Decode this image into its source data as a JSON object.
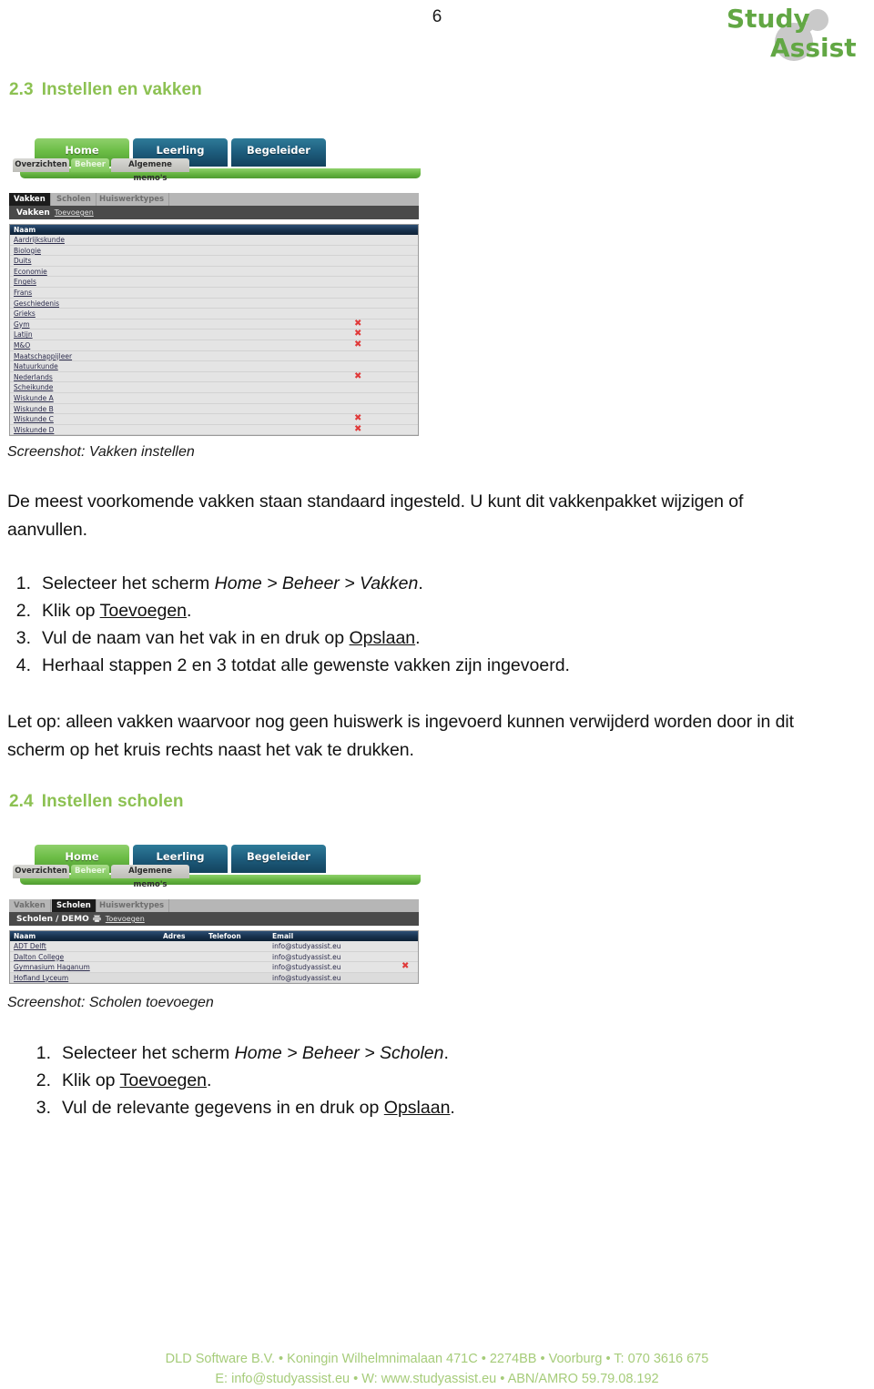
{
  "page": {
    "number": "6",
    "logo": {
      "word1": "Study",
      "word2": "Assist",
      "color": "#62a744",
      "shape_color": "#c9c9c9"
    }
  },
  "sections": [
    {
      "number": "2.3",
      "title": "Instellen en vakken",
      "caption": "Screenshot: Vakken instellen",
      "paragraph": "De meest voorkomende vakken staan standaard ingesteld. U kunt dit vakkenpakket  wijzigen of aanvullen.",
      "steps": [
        {
          "n": "1.",
          "pre": "Selecteer het scherm ",
          "italic": "Home > Beheer > Vakken",
          "post": "."
        },
        {
          "n": "2.",
          "pre": "Klik op ",
          "underline": "Toevoegen",
          "post": "."
        },
        {
          "n": "3.",
          "pre": "Vul de naam van het vak in en druk op ",
          "underline": "Opslaan",
          "post": "."
        },
        {
          "n": "4.",
          "pre": "Herhaal stappen 2 en 3 totdat alle gewenste vakken zijn ingevoerd.",
          "post": ""
        }
      ],
      "note": "Let op: alleen vakken waarvoor nog geen huiswerk is ingevoerd kunnen verwijderd worden door in dit scherm op het kruis rechts naast het vak te drukken."
    },
    {
      "number": "2.4",
      "title": "Instellen scholen",
      "caption": "Screenshot: Scholen toevoegen",
      "steps": [
        {
          "n": "1.",
          "pre": "Selecteer het scherm ",
          "italic": "Home > Beheer > Scholen",
          "post": "."
        },
        {
          "n": "2.",
          "pre": "Klik op ",
          "underline": "Toevoegen",
          "post": "."
        },
        {
          "n": "3.",
          "pre": "Vul de relevante gegevens in en druk op ",
          "underline": "Opslaan",
          "post": "."
        }
      ]
    }
  ],
  "app": {
    "main_tabs": [
      {
        "label": "Home",
        "state": "active",
        "color": "#6cbd46"
      },
      {
        "label": "Leerling",
        "state": "inactive",
        "color": "#1d5c7c"
      },
      {
        "label": "Begeleider",
        "state": "inactive",
        "color": "#1d5c7c"
      }
    ],
    "sub_tabs": [
      {
        "label": "Overzichten",
        "state": "inactive"
      },
      {
        "label": "Beheer",
        "state": "active"
      },
      {
        "label": "Algemene memo's",
        "state": "inactive"
      }
    ],
    "module_tabs": [
      "Vakken",
      "Scholen",
      "Huiswerktypes"
    ],
    "toevoegen_link": "Toevoegen",
    "vakken": {
      "active_module": "Vakken",
      "breadcrumb": "Vakken",
      "column_header": "Naam",
      "rows": [
        {
          "name": "Aardrijkskunde",
          "deletable": false
        },
        {
          "name": "Biologie",
          "deletable": false
        },
        {
          "name": "Duits",
          "deletable": false
        },
        {
          "name": "Economie",
          "deletable": false
        },
        {
          "name": "Engels",
          "deletable": false
        },
        {
          "name": "Frans",
          "deletable": false
        },
        {
          "name": "Geschiedenis",
          "deletable": false
        },
        {
          "name": "Grieks",
          "deletable": false
        },
        {
          "name": "Gym",
          "deletable": true
        },
        {
          "name": "Latijn",
          "deletable": true
        },
        {
          "name": "M&O",
          "deletable": true
        },
        {
          "name": "Maatschappijleer",
          "deletable": false
        },
        {
          "name": "Natuurkunde",
          "deletable": false
        },
        {
          "name": "Nederlands",
          "deletable": true
        },
        {
          "name": "Scheikunde",
          "deletable": false
        },
        {
          "name": "Wiskunde A",
          "deletable": false
        },
        {
          "name": "Wiskunde B",
          "deletable": false
        },
        {
          "name": "Wiskunde C",
          "deletable": true
        },
        {
          "name": "Wiskunde D",
          "deletable": true
        }
      ]
    },
    "scholen": {
      "active_module": "Scholen",
      "breadcrumb": "Scholen / DEMO",
      "columns": [
        "Naam",
        "Adres",
        "Telefoon",
        "Email"
      ],
      "rows": [
        {
          "name": "ADT Delft",
          "adres": "",
          "telefoon": "",
          "email": "info@studyassist.eu",
          "deletable": false
        },
        {
          "name": "Dalton College",
          "adres": "",
          "telefoon": "",
          "email": "info@studyassist.eu",
          "deletable": false
        },
        {
          "name": "Gymnasium Haganum",
          "adres": "",
          "telefoon": "",
          "email": "info@studyassist.eu",
          "deletable": true
        },
        {
          "name": "Hofland Lyceum",
          "adres": "",
          "telefoon": "",
          "email": "info@studyassist.eu",
          "deletable": false
        }
      ]
    },
    "delete_icon": "✖"
  },
  "footer": {
    "line1": "DLD Software B.V. • Koningin Wilhelmnimalaan 471C • 2274BB • Voorburg • T: 070 3616 675",
    "line2": "E: info@studyassist.eu • W: www.studyassist.eu • ABN/AMRO 59.79.08.192"
  }
}
